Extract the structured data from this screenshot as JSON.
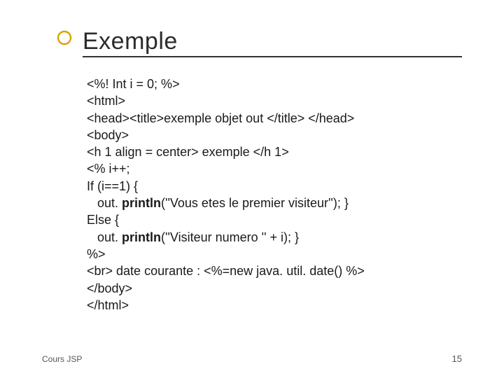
{
  "title": "Exemple",
  "code": {
    "l1": "<%! Int i = 0; %>",
    "l2": "<html>",
    "l3": "<head><title>exemple objet out </title> </head>",
    "l4": "<body>",
    "l5": "<h 1 align = center> exemple </h 1>",
    "l6": "<% i++;",
    "l7": "If (i==1) {",
    "l8a": "   out. ",
    "l8b": "println",
    "l8c": "(''Vous etes le premier visiteur''); }",
    "l9": "Else {",
    "l10a": "   out. ",
    "l10b": "println",
    "l10c": "(''Visiteur numero '' + i); }",
    "l11": "%>",
    "l12": "<br> date courante : <%=new java. util. date() %>",
    "l13": "</body>",
    "l14": "</html>"
  },
  "footer": {
    "left": "Cours JSP",
    "right": "15"
  }
}
